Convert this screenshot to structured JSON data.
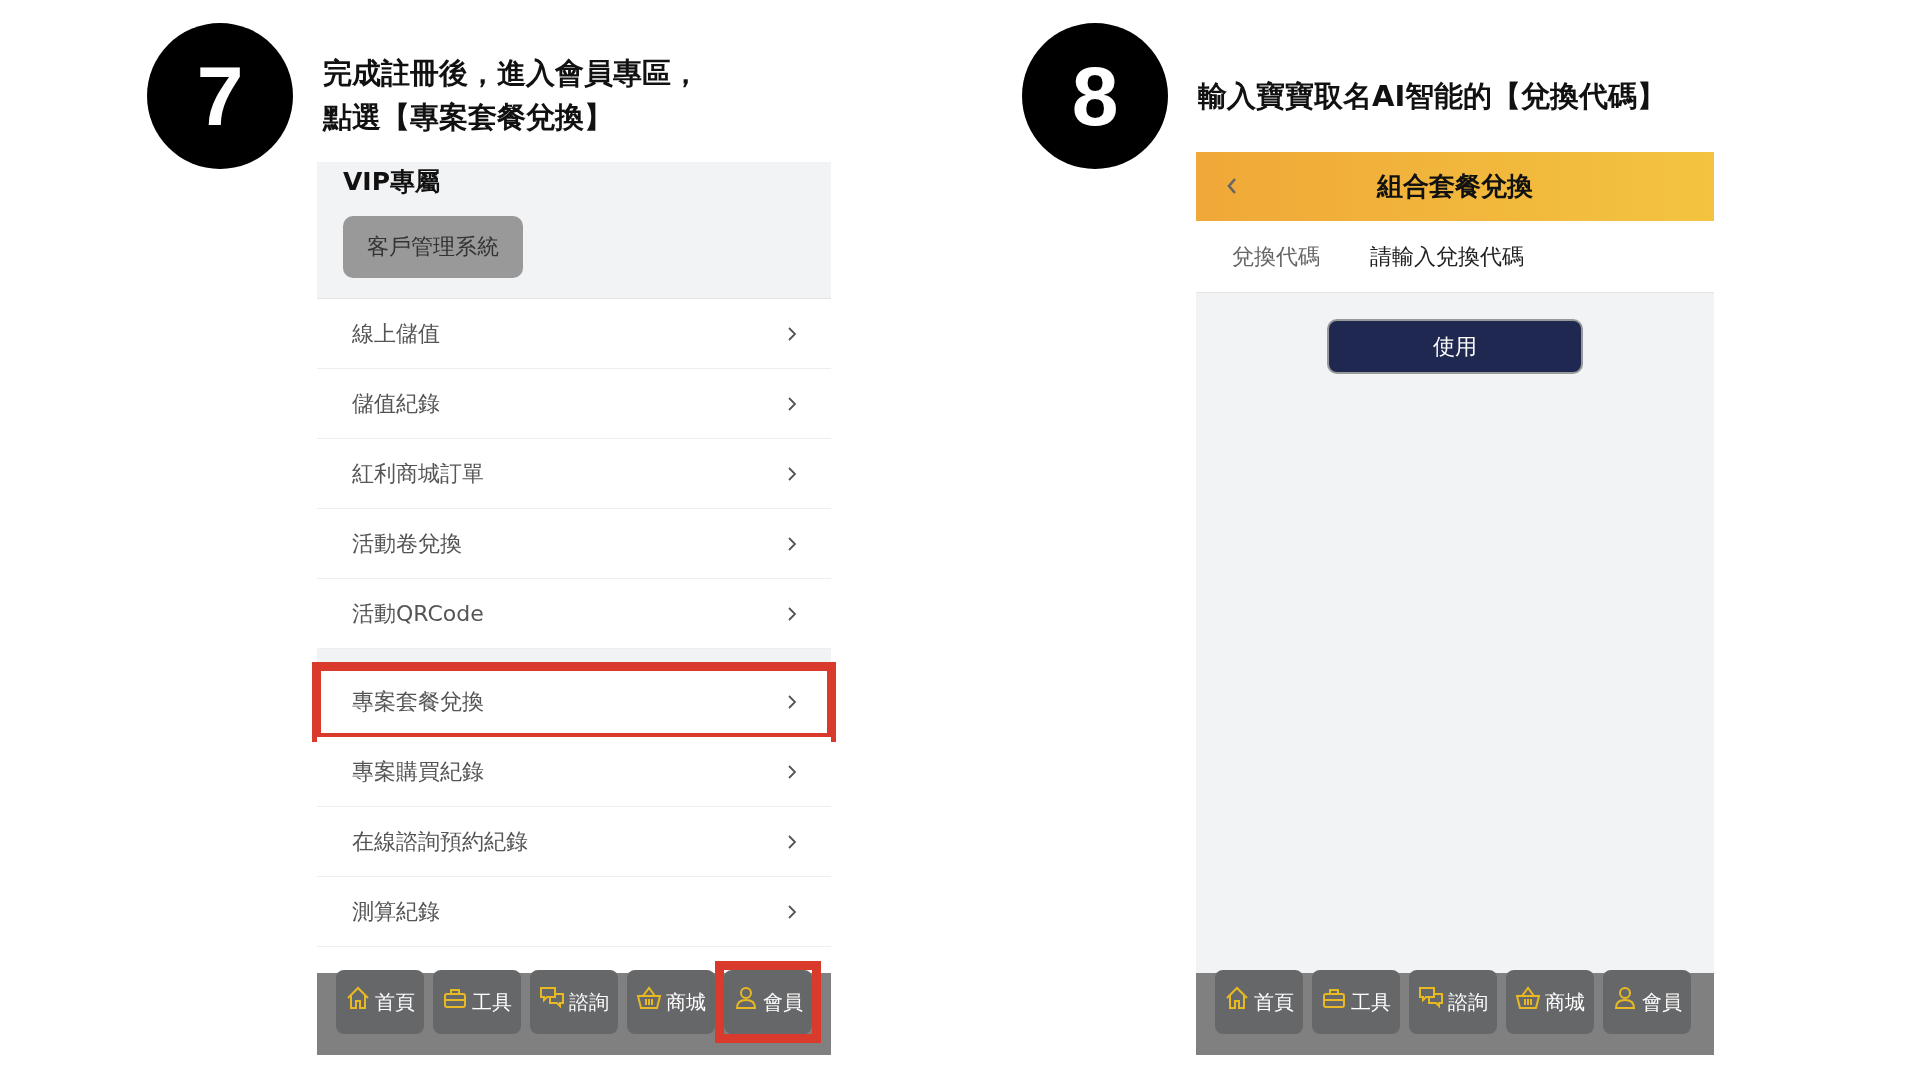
{
  "steps": [
    {
      "number": "7",
      "kind": "menu",
      "instruction_lines": [
        "完成註冊後，進入會員專區，",
        "點選【專案套餐兌換】"
      ],
      "screen": {
        "section_title": "VIP專屬",
        "section_button": "客戶管理系統",
        "menu_groups": [
          [
            {
              "label": "線上儲值",
              "highlighted": false
            },
            {
              "label": "儲值紀錄",
              "highlighted": false
            },
            {
              "label": "紅利商城訂單",
              "highlighted": false
            },
            {
              "label": "活動卷兌換",
              "highlighted": false
            },
            {
              "label": "活動QRCode",
              "highlighted": false
            }
          ],
          [
            {
              "label": "專案套餐兌換",
              "highlighted": true
            },
            {
              "label": "專案購買紀錄",
              "highlighted": false
            },
            {
              "label": "在線諮詢預約紀錄",
              "highlighted": false
            },
            {
              "label": "測算紀錄",
              "highlighted": false
            }
          ]
        ],
        "tab_bar": [
          {
            "label": "首頁",
            "highlighted": false
          },
          {
            "label": "工具",
            "highlighted": false
          },
          {
            "label": "諮詢",
            "highlighted": false
          },
          {
            "label": "商城",
            "highlighted": false
          },
          {
            "label": "會員",
            "highlighted": true
          }
        ]
      }
    },
    {
      "number": "8",
      "kind": "redeem",
      "instruction_lines": [
        "輸入寶寶取名AI智能的【兌換代碼】"
      ],
      "screen": {
        "title": "組合套餐兌換",
        "field_label": "兌換代碼",
        "field_placeholder": "請輸入兌換代碼",
        "submit_button": "使用",
        "tab_bar": [
          {
            "label": "首頁",
            "highlighted": false
          },
          {
            "label": "工具",
            "highlighted": false
          },
          {
            "label": "諮詢",
            "highlighted": false
          },
          {
            "label": "商城",
            "highlighted": false
          },
          {
            "label": "會員",
            "highlighted": false
          }
        ]
      }
    }
  ]
}
